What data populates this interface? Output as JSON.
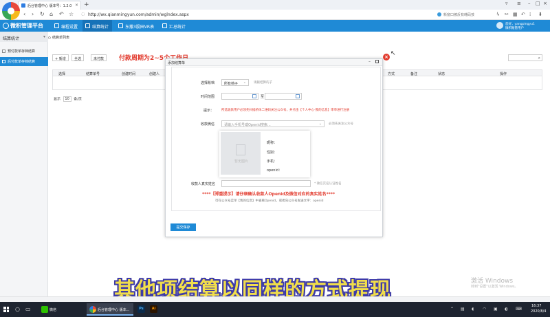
{
  "browser": {
    "tab_title": "后台管理中心 版本号：1.2.0",
    "new_tab": "+",
    "address": "http://wx.qianmingyun.com/admin/wglndex.aspx",
    "hint": "新窗口被反有韩码孩"
  },
  "app": {
    "brand": "微积管理平台",
    "nav": [
      "编程设置",
      "结算统计",
      "东撒3股田VR表",
      "汇总统计"
    ],
    "user_line1": "您好，yangpingyu1",
    "user_line2": "微积账管用户"
  },
  "sidebar": {
    "header": "结算统计",
    "items": [
      "预付款单存档结算",
      "后付款单存档结算"
    ]
  },
  "content": {
    "breadcrumb": "结算单列表",
    "btn_add": "+ 新增",
    "btn_all": "全选",
    "btn_filter": "未付款",
    "notice": "付款周期为2~5个工作日",
    "columns": [
      "选择",
      "结算单号",
      "创建时间",
      "创建人",
      "方式",
      "备注",
      "状态",
      "操作"
    ],
    "pager_show": "显示",
    "pager_size": "10",
    "pager_unit": "条/页"
  },
  "modal": {
    "title": "添加结算单",
    "label_select": "选择账档",
    "select_value": "所有档子",
    "select_hint": "请删结算的子",
    "label_time": "时间范围",
    "time_to": "至",
    "label_tip": "提示：",
    "tip_text": "所选收款用户必须先扫描桥体二维码关注公众号，并点击【个人中心-我的信息】审单进行注册",
    "label_wechat": "收款微信",
    "wechat_placeholder": "请输入手机号或Openid搜索...",
    "wechat_hint": "必须先关注公众号",
    "card_img_text": "暂无图片",
    "card_nick": "昵称：",
    "card_gender": "性别：",
    "card_phone": "手机：",
    "card_openid": "openid：",
    "label_realname": "收款人真实姓名",
    "realname_hint": "* 微信实名认证姓名",
    "warning": "****【郑重提示】请仔细确认收款人Openid及微信对应的真实姓名****",
    "warning_sub": "可在公众号菜单【我的信息】中查看Openid，或者向公众号发送文字：openid",
    "submit": "提交保存"
  },
  "watermark": {
    "line1": "激活 Windows",
    "line2": "转到\"设置\"以激活 Windows。"
  },
  "caption": "其他项结算以同样的方式提现",
  "taskbar": {
    "task_wechat": "微信",
    "task_browser": "后台管理中心 版本...",
    "app_ps": "Ps",
    "app_ai": "Ai",
    "time": "16:37",
    "date": "2020/8/4"
  }
}
